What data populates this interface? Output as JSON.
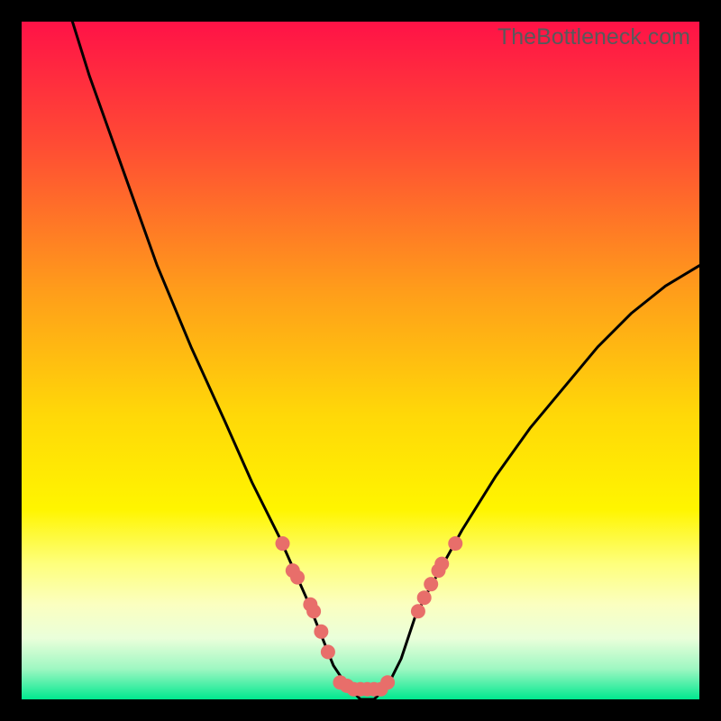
{
  "watermark": "TheBottleneck.com",
  "colors": {
    "gradient_top": "#ff1247",
    "gradient_mid1": "#ff7d22",
    "gradient_mid2": "#ffe208",
    "gradient_mid3": "#feff7c",
    "gradient_bottom": "#00e88f",
    "curve": "#000000",
    "marker": "#e86e6a",
    "frame": "#000000"
  },
  "chart_data": {
    "type": "line",
    "title": "",
    "xlabel": "",
    "ylabel": "",
    "xlim": [
      0,
      100
    ],
    "ylim": [
      0,
      100
    ],
    "series": [
      {
        "name": "bottleneck-curve",
        "x": [
          7.5,
          10,
          15,
          20,
          25,
          30,
          34,
          38,
          42,
          44,
          46,
          48,
          50,
          52,
          54,
          56,
          58,
          60,
          65,
          70,
          75,
          80,
          85,
          90,
          95,
          100
        ],
        "y": [
          100,
          92,
          78,
          64,
          52,
          41,
          32,
          24,
          15,
          10,
          5,
          2,
          0,
          0,
          2,
          6,
          12,
          16,
          25,
          33,
          40,
          46,
          52,
          57,
          61,
          64
        ]
      }
    ],
    "markers": [
      {
        "x": 38.5,
        "y": 23
      },
      {
        "x": 40.0,
        "y": 19
      },
      {
        "x": 40.7,
        "y": 18
      },
      {
        "x": 42.6,
        "y": 14
      },
      {
        "x": 43.1,
        "y": 13
      },
      {
        "x": 44.2,
        "y": 10
      },
      {
        "x": 45.2,
        "y": 7
      },
      {
        "x": 47.0,
        "y": 2.5
      },
      {
        "x": 48.0,
        "y": 2
      },
      {
        "x": 49.0,
        "y": 1.5
      },
      {
        "x": 50.0,
        "y": 1.5
      },
      {
        "x": 51.0,
        "y": 1.5
      },
      {
        "x": 52.0,
        "y": 1.5
      },
      {
        "x": 53.0,
        "y": 1.5
      },
      {
        "x": 54.0,
        "y": 2.5
      },
      {
        "x": 58.5,
        "y": 13
      },
      {
        "x": 59.4,
        "y": 15
      },
      {
        "x": 60.4,
        "y": 17
      },
      {
        "x": 61.5,
        "y": 19
      },
      {
        "x": 62.0,
        "y": 20
      },
      {
        "x": 64.0,
        "y": 23
      }
    ]
  }
}
